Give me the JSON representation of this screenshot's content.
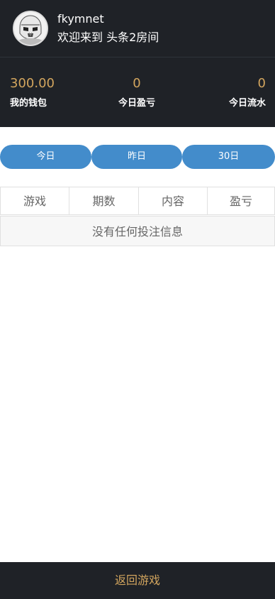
{
  "header": {
    "username": "fkymnet",
    "welcome": "欢迎来到 头条2房间"
  },
  "stats": [
    {
      "value": "300.00",
      "label": "我的钱包"
    },
    {
      "value": "0",
      "label": "今日盈亏"
    },
    {
      "value": "0",
      "label": "今日流水"
    }
  ],
  "tabs": [
    "今日",
    "昨日",
    "30日"
  ],
  "table": {
    "columns": [
      "游戏",
      "期数",
      "内容",
      "盈亏"
    ],
    "empty_message": "没有任何投注信息"
  },
  "footer": {
    "back_label": "返回游戏"
  },
  "colors": {
    "dark_bg": "#1f2227",
    "accent_gold": "#d2a55e",
    "tab_blue": "#438ccb"
  },
  "icons": {
    "avatar": "stormtrooper-avatar-icon"
  }
}
